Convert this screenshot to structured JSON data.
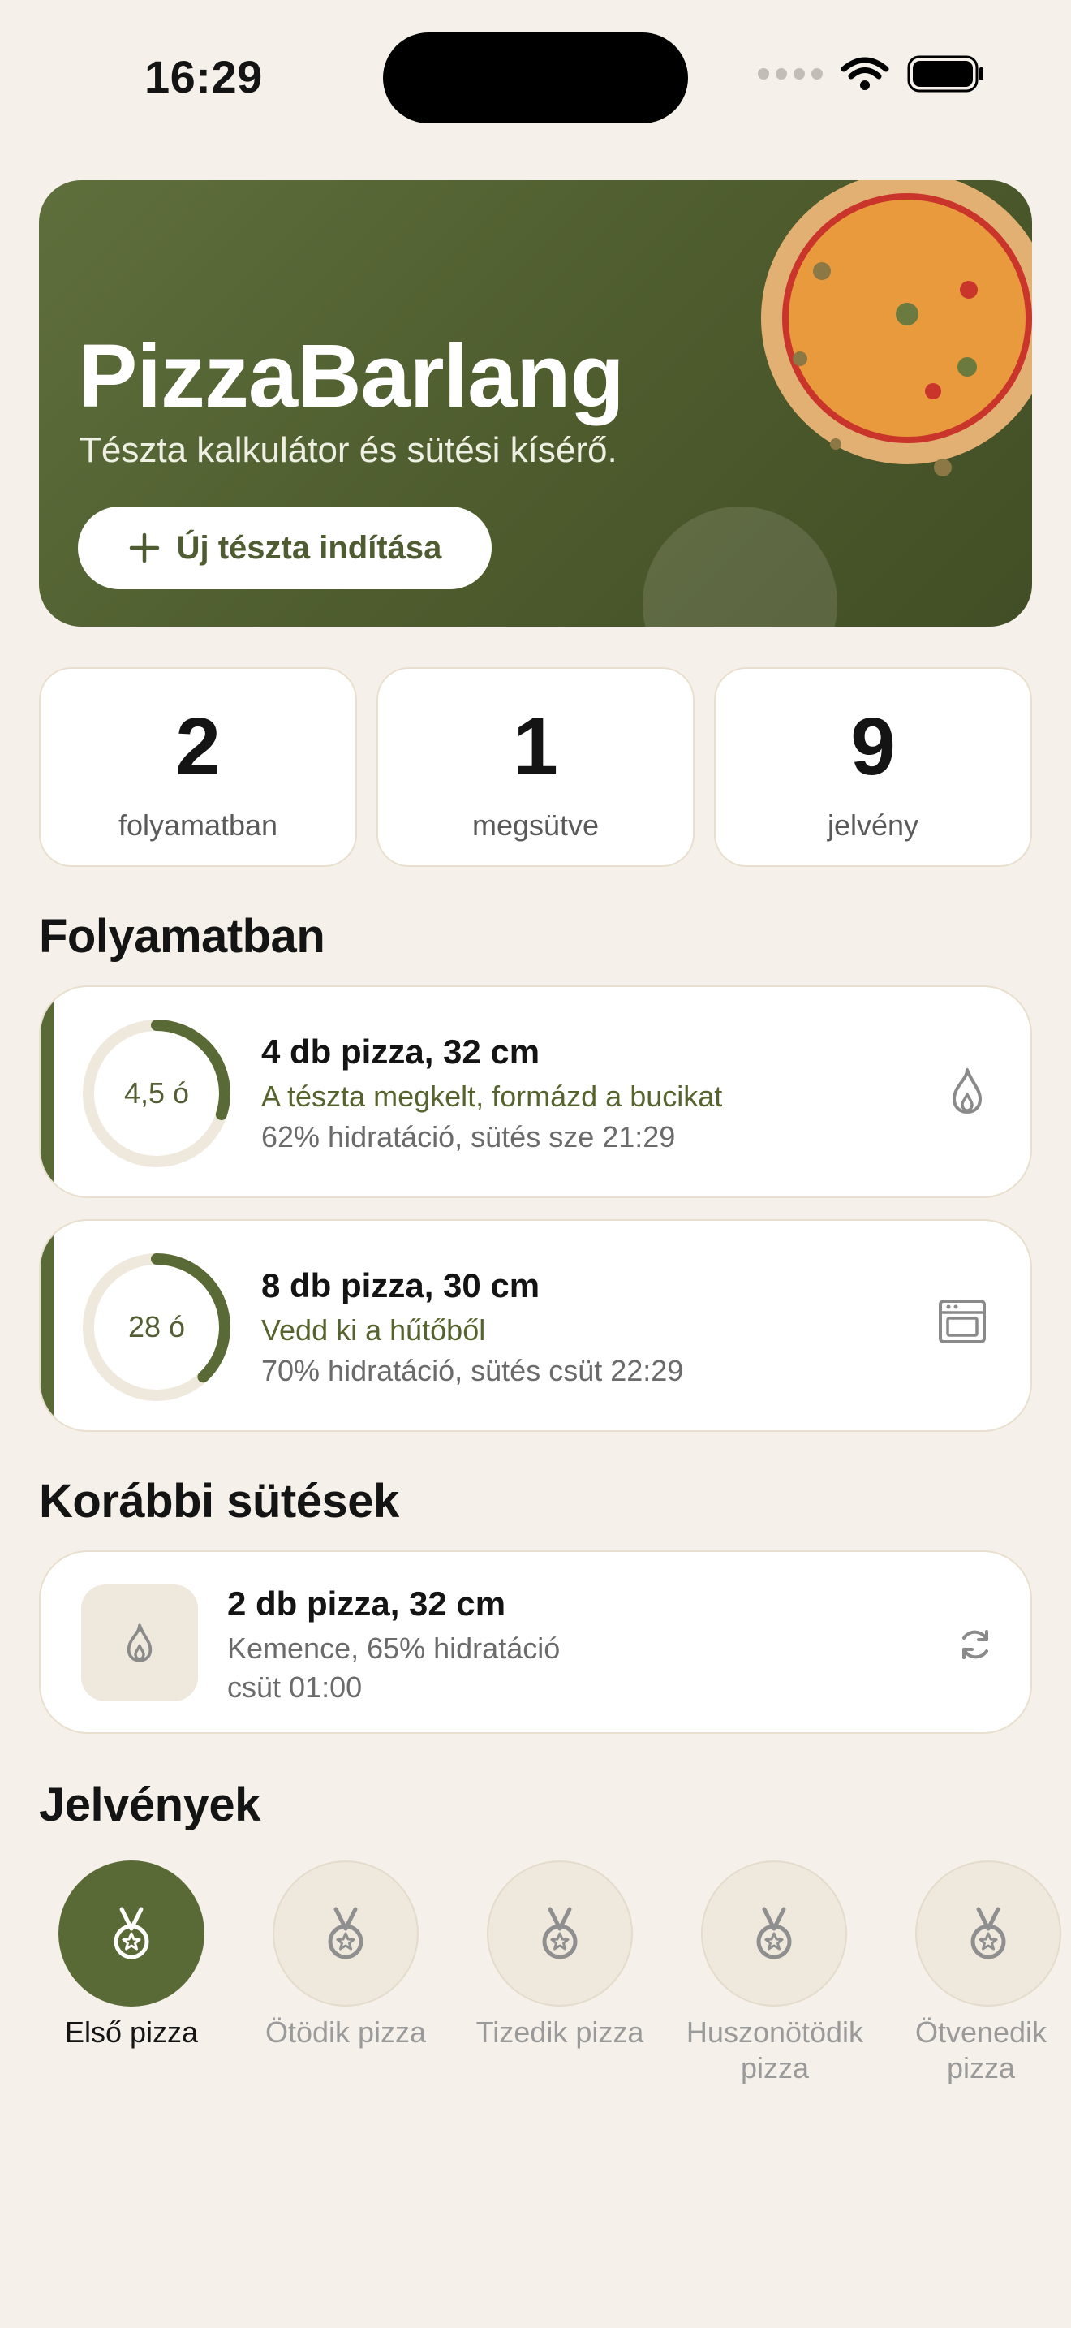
{
  "status_bar": {
    "time": "16:29"
  },
  "hero": {
    "title": "PizzaBarlang",
    "subtitle": "Tészta kalkulátor és sütési kísérő.",
    "button_icon": "plus-icon",
    "button_label": "Új tészta indítása",
    "colors": {
      "background": "#4d5b2d",
      "button_text": "#4f5c31",
      "pizza_crust": "#e3b074",
      "pizza_sauce": "#e89a3c",
      "pizza_rim": "#c9352b"
    }
  },
  "stats": [
    {
      "value": "2",
      "label": "folyamatban"
    },
    {
      "value": "1",
      "label": "megsütve"
    },
    {
      "value": "9",
      "label": "jelvény"
    }
  ],
  "in_progress": {
    "title": "Folyamatban",
    "items": [
      {
        "ring_label": "4,5 ó",
        "progress": 0.3,
        "title": "4 db pizza, 32 cm",
        "step": "A tészta megkelt, formázd a bucikat",
        "meta": "62% hidratáció, sütés sze 21:29",
        "icon": "flame-icon"
      },
      {
        "ring_label": "28 ó",
        "progress": 0.38,
        "title": "8 db pizza, 30 cm",
        "step": "Vedd ki a hűtőből",
        "meta": "70% hidratáció, sütés csüt 22:29",
        "icon": "oven-icon"
      }
    ]
  },
  "history": {
    "title": "Korábbi sütések",
    "items": [
      {
        "title": "2 db pizza, 32 cm",
        "subtitle": "Kemence, 65% hidratáció",
        "date": "csüt 01:00",
        "thumb_icon": "flame-icon",
        "action_icon": "repeat-icon"
      }
    ]
  },
  "badges": {
    "title": "Jelvények",
    "items": [
      {
        "label": "Első pizza",
        "unlocked": true
      },
      {
        "label": "Ötödik pizza",
        "unlocked": false
      },
      {
        "label": "Tizedik pizza",
        "unlocked": false
      },
      {
        "label": "Huszonötödik pizza",
        "unlocked": false
      },
      {
        "label": "Ötvenedik pizza",
        "unlocked": false
      }
    ]
  },
  "colors": {
    "accent": "#5a6a36",
    "page_bg": "#f5f0e9",
    "card_border": "#e8dfcf"
  }
}
